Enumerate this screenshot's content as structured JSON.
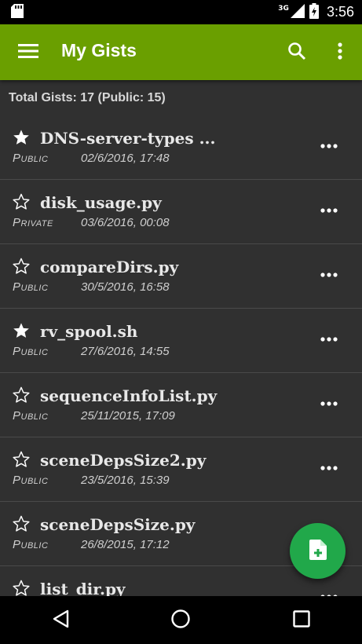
{
  "status_bar": {
    "network": "3G",
    "time": "3:56",
    "icons": [
      "sd-card-icon",
      "signal-icon",
      "battery-charging-icon"
    ]
  },
  "app_bar": {
    "title": "My Gists",
    "icons": [
      "menu-icon",
      "search-icon",
      "more-vert-icon"
    ]
  },
  "summary": "Total Gists: 17 (Public: 15)",
  "gists": [
    {
      "name": "DNS-server-types ...",
      "visibility": "Public",
      "date": "02/6/2016, 17:48",
      "starred": true
    },
    {
      "name": "disk_usage.py",
      "visibility": "Private",
      "date": "03/6/2016, 00:08",
      "starred": false
    },
    {
      "name": "compareDirs.py",
      "visibility": "Public",
      "date": "30/5/2016, 16:58",
      "starred": false
    },
    {
      "name": "rv_spool.sh",
      "visibility": "Public",
      "date": "27/6/2016, 14:55",
      "starred": true
    },
    {
      "name": "sequenceInfoList.py",
      "visibility": "Public",
      "date": "25/11/2015, 17:09",
      "starred": false
    },
    {
      "name": "sceneDepsSize2.py",
      "visibility": "Public",
      "date": "23/5/2016, 15:39",
      "starred": false
    },
    {
      "name": "sceneDepsSize.py",
      "visibility": "Public",
      "date": "26/8/2015, 17:12",
      "starred": false
    },
    {
      "name": "list_dir.py",
      "visibility": "",
      "date": "",
      "starred": false
    }
  ],
  "fab": {
    "icon": "new-file-icon"
  },
  "nav_bar": {
    "icons": [
      "back-icon",
      "home-icon",
      "recents-icon"
    ]
  },
  "colors": {
    "app_bar": "#6a9f00",
    "fab": "#21a84a",
    "background": "#303030"
  }
}
